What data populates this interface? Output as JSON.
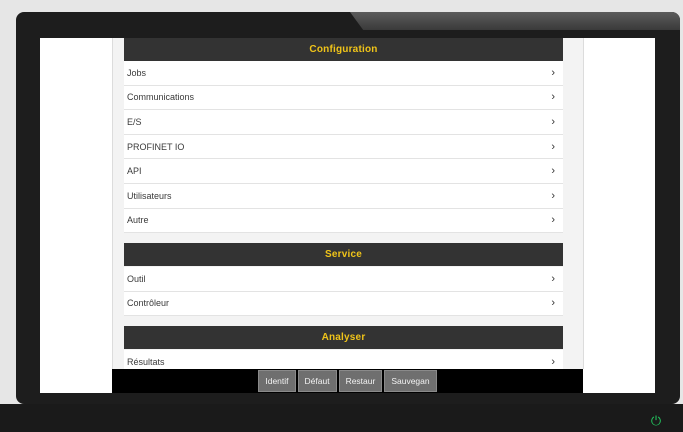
{
  "sections": [
    {
      "title": "Configuration",
      "items": [
        "Jobs",
        "Communications",
        "E/S",
        "PROFINET IO",
        "API",
        "Utilisateurs",
        "Autre"
      ]
    },
    {
      "title": "Service",
      "items": [
        "Outil",
        "Contrôleur"
      ]
    },
    {
      "title": "Analyser",
      "items": [
        "Résultats"
      ]
    }
  ],
  "chevron": "›",
  "footer": {
    "buttons": [
      "Identif",
      "Défaut",
      "Restaur",
      "Sauvegan"
    ]
  },
  "colors": {
    "header_bg": "#333333",
    "header_text": "#f0c419",
    "power_indicator": "#22c55e"
  },
  "icons": {
    "power": "power-icon"
  }
}
